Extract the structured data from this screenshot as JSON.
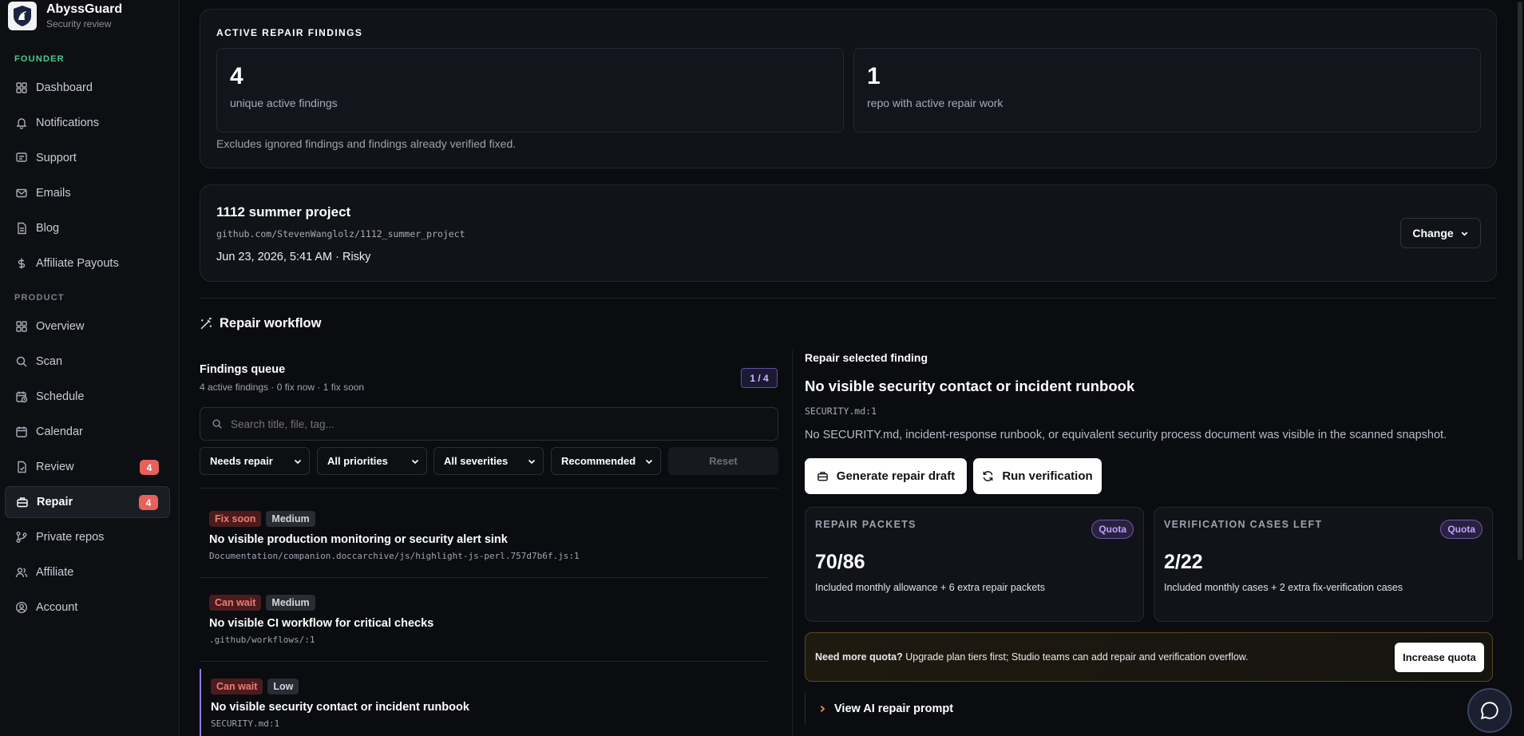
{
  "brand": {
    "name": "AbyssGuard",
    "subtitle": "Security review"
  },
  "sidebar": {
    "founder_label": "FOUNDER",
    "product_label": "PRODUCT",
    "founder_items": [
      {
        "label": "Dashboard",
        "icon": "dashboard-icon"
      },
      {
        "label": "Notifications",
        "icon": "bell-icon"
      },
      {
        "label": "Support",
        "icon": "message-icon"
      },
      {
        "label": "Emails",
        "icon": "mail-icon"
      },
      {
        "label": "Blog",
        "icon": "document-icon"
      },
      {
        "label": "Affiliate Payouts",
        "icon": "dollar-icon"
      }
    ],
    "product_items": [
      {
        "label": "Overview",
        "icon": "dashboard-icon"
      },
      {
        "label": "Scan",
        "icon": "search-icon"
      },
      {
        "label": "Schedule",
        "icon": "calendar-clock-icon"
      },
      {
        "label": "Calendar",
        "icon": "calendar-icon"
      },
      {
        "label": "Review",
        "icon": "review-doc-icon",
        "badge": "4"
      },
      {
        "label": "Repair",
        "icon": "toolbox-icon",
        "badge": "4",
        "active": true
      },
      {
        "label": "Private repos",
        "icon": "git-branch-icon"
      },
      {
        "label": "Affiliate",
        "icon": "users-icon"
      },
      {
        "label": "Account",
        "icon": "user-circle-icon"
      }
    ],
    "colors": {
      "founder_label": "#3ecf8e",
      "product_label": "#7b7f8c"
    }
  },
  "findings_summary": {
    "title": "ACTIVE REPAIR FINDINGS",
    "stat1": {
      "value": "4",
      "label": "unique active findings"
    },
    "stat2": {
      "value": "1",
      "label": "repo with active repair work"
    },
    "note": "Excludes ignored findings and findings already verified fixed."
  },
  "project": {
    "name": "1112 summer project",
    "repo": "github.com/StevenWanglolz/1112_summer_project",
    "meta": "Jun 23, 2026, 5:41 AM · Risky",
    "change_label": "Change"
  },
  "workflow": {
    "title": "Repair workflow",
    "queue_title": "Findings queue",
    "queue_sub": "4 active findings · 0 fix now · 1 fix soon",
    "page_indicator": "1 / 4",
    "search_placeholder": "Search title, file, tag...",
    "filters": {
      "status": "Needs repair",
      "priority": "All priorities",
      "severity": "All severities",
      "sort": "Recommended",
      "reset": "Reset"
    },
    "findings": [
      {
        "urgency": "Fix soon",
        "severity": "Medium",
        "title": "No visible production monitoring or security alert sink",
        "path": "Documentation/companion.doccarchive/js/highlight-js-perl.757d7b6f.js:1"
      },
      {
        "urgency": "Can wait",
        "severity": "Medium",
        "title": "No visible CI workflow for critical checks",
        "path": ".github/workflows/:1"
      },
      {
        "urgency": "Can wait",
        "severity": "Low",
        "title": "No visible security contact or incident runbook",
        "path": "SECURITY.md:1"
      }
    ]
  },
  "detail": {
    "eyebrow": "Repair selected finding",
    "title": "No visible security contact or incident runbook",
    "path": "SECURITY.md:1",
    "description": "No SECURITY.md, incident-response runbook, or equivalent security process document was visible in the scanned snapshot.",
    "generate_label": "Generate repair draft",
    "verify_label": "Run verification",
    "quota": [
      {
        "title": "REPAIR PACKETS",
        "pill": "Quota",
        "value": "70/86",
        "desc": "Included monthly allowance + 6 extra repair packets"
      },
      {
        "title": "VERIFICATION CASES LEFT",
        "pill": "Quota",
        "value": "2/22",
        "desc": "Included monthly cases + 2 extra fix-verification cases"
      }
    ],
    "upsell_bold": "Need more quota?",
    "upsell_text": " Upgrade plan tiers first; Studio teams can add repair and verification overflow.",
    "increase_label": "Increase quota",
    "prompt_label": "View AI repair prompt"
  }
}
